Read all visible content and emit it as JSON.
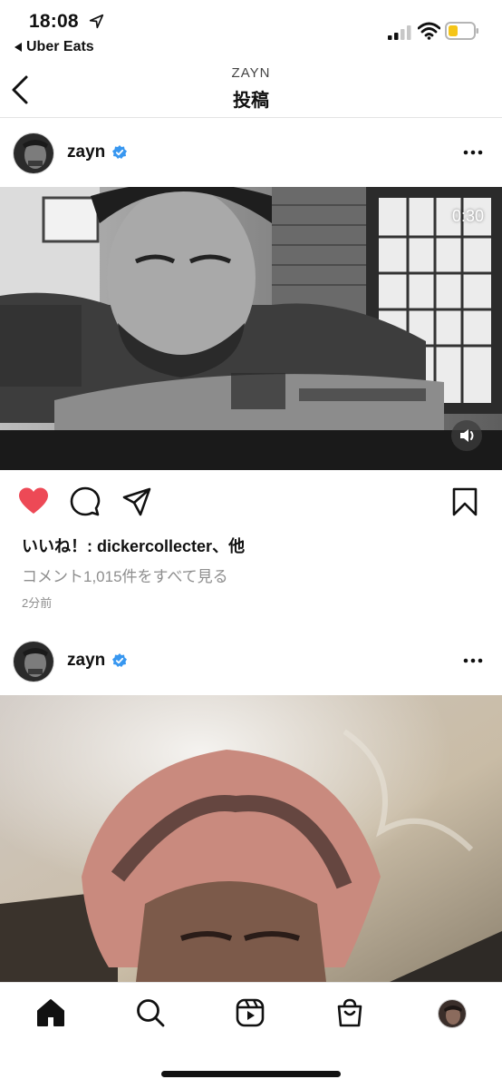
{
  "status_bar": {
    "time": "18:08",
    "back_app": "Uber Eats",
    "battery_color": "#f5c518"
  },
  "nav": {
    "subtitle": "ZAYN",
    "title": "投稿"
  },
  "posts": [
    {
      "username": "zayn",
      "verified": true,
      "media": {
        "type": "video",
        "duration": "0:30",
        "tone": "black-and-white"
      },
      "liked": true,
      "likes_text": "いいね！: dickercollecter、他",
      "comments_text": "コメント1,015件をすべて見る",
      "time_ago": "2分前"
    },
    {
      "username": "zayn",
      "verified": true,
      "media": {
        "type": "photo",
        "tone": "warm"
      }
    }
  ],
  "icons": {
    "heart": "heart-filled-icon",
    "comment": "comment-icon",
    "share": "send-icon",
    "save": "bookmark-icon",
    "more": "more-horizontal-icon",
    "back": "chevron-left-icon",
    "verified": "verified-badge-icon"
  },
  "colors": {
    "like_red": "#ed4956",
    "verified_blue": "#3897f0",
    "muted_text": "#8e8e8e"
  },
  "tabbar": {
    "tabs": [
      "home",
      "search",
      "reels",
      "shop",
      "profile"
    ],
    "active": "home"
  }
}
